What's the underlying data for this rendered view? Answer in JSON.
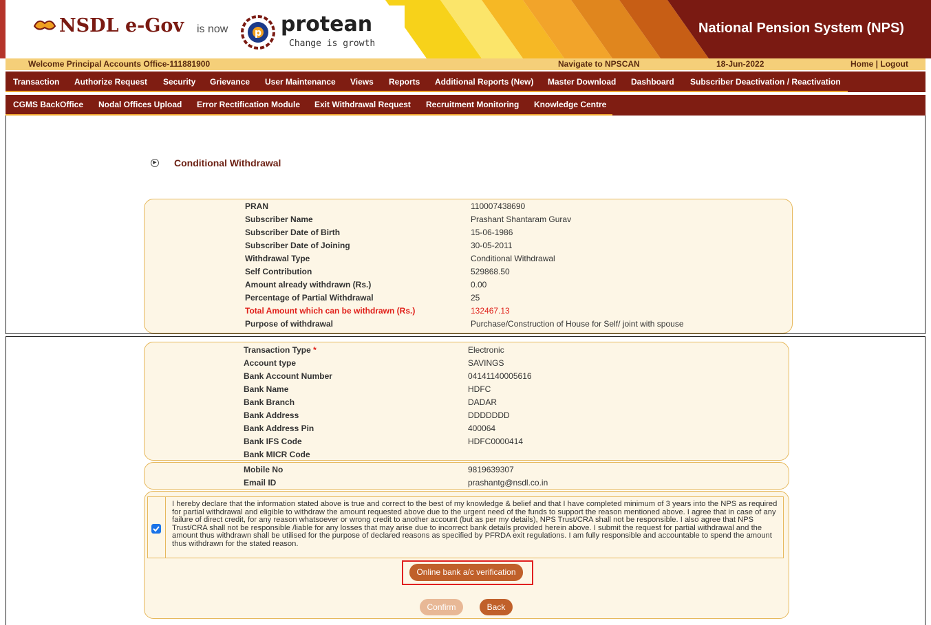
{
  "header": {
    "brand_left": "NSDL e-Gov",
    "is_now": "is now",
    "brand_right": "protean",
    "tagline": "Change is growth",
    "system_title": "National Pension System (NPS)"
  },
  "info_row": {
    "welcome": "Welcome Principal Accounts Office-111881900",
    "navigate": "Navigate to NPSCAN",
    "date": "18-Jun-2022",
    "home_logout": "Home | Logout"
  },
  "menu_primary": [
    "Transaction",
    "Authorize Request",
    "Security",
    "Grievance",
    "User Maintenance",
    "Views",
    "Reports",
    "Additional Reports (New)",
    "Master Download",
    "Dashboard",
    "Subscriber Deactivation / Reactivation"
  ],
  "menu_secondary": [
    "CGMS BackOffice",
    "Nodal Offices Upload",
    "Error Rectification Module",
    "Exit Withdrawal Request",
    "Recruitment Monitoring",
    "Knowledge Centre"
  ],
  "page_title": "Conditional Withdrawal",
  "subscriber_details": [
    {
      "label": "PRAN",
      "value": "110007438690"
    },
    {
      "label": "Subscriber Name",
      "value": "Prashant Shantaram Gurav"
    },
    {
      "label": "Subscriber Date of Birth",
      "value": "15-06-1986"
    },
    {
      "label": "Subscriber Date of Joining",
      "value": "30-05-2011"
    },
    {
      "label": "Withdrawal Type",
      "value": "Conditional Withdrawal"
    },
    {
      "label": "Self Contribution",
      "value": "529868.50"
    },
    {
      "label": "Amount already withdrawn (Rs.)",
      "value": "0.00"
    },
    {
      "label": "Percentage of Partial Withdrawal",
      "value": "25"
    },
    {
      "label": "Total Amount which can be withdrawn (Rs.)",
      "value": "132467.13"
    },
    {
      "label": "Purpose of withdrawal",
      "value": "Purchase/Construction of House for Self/ joint with spouse"
    }
  ],
  "bank_details": [
    {
      "label": "Transaction Type",
      "value": "Electronic"
    },
    {
      "label": "Account type",
      "value": "SAVINGS"
    },
    {
      "label": "Bank Account Number",
      "value": "04141140005616"
    },
    {
      "label": "Bank Name",
      "value": "HDFC"
    },
    {
      "label": "Bank Branch",
      "value": "DADAR"
    },
    {
      "label": "Bank Address",
      "value": "DDDDDDD"
    },
    {
      "label": "Bank Address Pin",
      "value": "400064"
    },
    {
      "label": "Bank IFS Code",
      "value": "HDFC0000414"
    },
    {
      "label": "Bank MICR Code",
      "value": ""
    }
  ],
  "required_marker": "*",
  "contact_details": [
    {
      "label": "Mobile No",
      "value": "9819639307"
    },
    {
      "label": "Email ID",
      "value": "prashantg@nsdl.co.in"
    }
  ],
  "declaration": {
    "checked": true,
    "text": "I hereby declare that the information stated above is true and correct to the best of my knowledge & belief and that I have completed minimum of 3 years into the NPS as required for partial withdrawal and eligible to withdraw the amount requested above due to the urgent need of the funds to support the reason mentioned above. I agree that in case of any failure of direct credit, for any reason whatsoever or wrong credit to another account (but as per my details), NPS Trust/CRA shall not be responsible. I also agree that NPS Trust/CRA shall not be responsible /liable for any losses that may arise due to incorrect bank details provided herein above. I submit the request for partial withdrawal and the amount thus withdrawn shall be utilised for the purpose of declared reasons as specified by PFRDA exit regulations. I am fully responsible and accountable to spend the amount thus withdrawn for the stated reason."
  },
  "buttons": {
    "verify": "Online bank a/c verification",
    "confirm": "Confirm",
    "back": "Back"
  },
  "colors": {
    "menu_bg": "#7f1d12",
    "info_bg": "#f5cf79",
    "panel_bg": "#fdf6e6",
    "panel_border": "#e6b85c",
    "button_bg": "#c0602a",
    "highlight": "#e02020",
    "alert_text": "#e0201a"
  }
}
